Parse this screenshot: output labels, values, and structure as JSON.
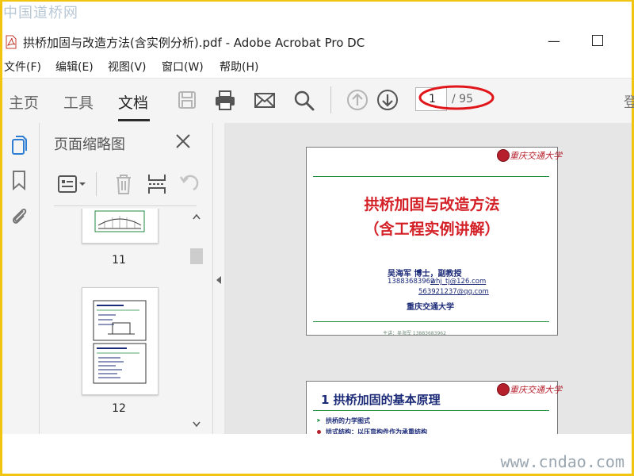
{
  "watermark": {
    "top": "中国道桥网",
    "bottom": "www.cndao.com"
  },
  "window": {
    "title": "拱桥加固与改造方法(含实例分析).pdf - Adobe Acrobat Pro DC",
    "icons": [
      "pdf-file-icon",
      "minimize-icon",
      "maximize-icon"
    ]
  },
  "menu": {
    "items": [
      "文件(F)",
      "编辑(E)",
      "视图(V)",
      "窗口(W)",
      "帮助(H)"
    ]
  },
  "toolbar": {
    "tabs": [
      {
        "label": "主页",
        "active": false
      },
      {
        "label": "工具",
        "active": false
      },
      {
        "label": "文档",
        "active": true
      }
    ],
    "tool_icons": [
      "save-icon",
      "print-icon",
      "email-icon",
      "search-icon",
      "prev-page-icon",
      "next-page-icon"
    ],
    "page_current": "1",
    "page_total": "/ 95",
    "login_partial": "登",
    "highlight_color": "#e0161b"
  },
  "rail": {
    "icons": [
      "page-thumbnails-icon",
      "bookmark-icon",
      "attachment-icon"
    ]
  },
  "thumbnails_panel": {
    "title": "页面缩略图",
    "tool_icons": [
      "options-menu-icon",
      "delete-icon",
      "insert-page-icon",
      "undo-icon"
    ],
    "pages": [
      {
        "label": "11"
      },
      {
        "label": "12"
      }
    ]
  },
  "document": {
    "slide1": {
      "logo": "重庆交通大学",
      "title": "拱桥加固与改造方法",
      "subtitle": "（含工程实例讲解）",
      "author": "吴海军   博士，副教授",
      "phone": "13883683962",
      "email1": "whj_tj@126.com",
      "email2": "563921237@qq.com",
      "university": "重庆交通大学",
      "footer": "主讲：吴海军  13883683962"
    },
    "slide2": {
      "logo": "重庆交通大学",
      "title": "1  拱桥加固的基本原理",
      "bullet1": "拱桥的力学图式",
      "bullet2": "拱式结构：以压弯构件作为承重结构"
    }
  }
}
